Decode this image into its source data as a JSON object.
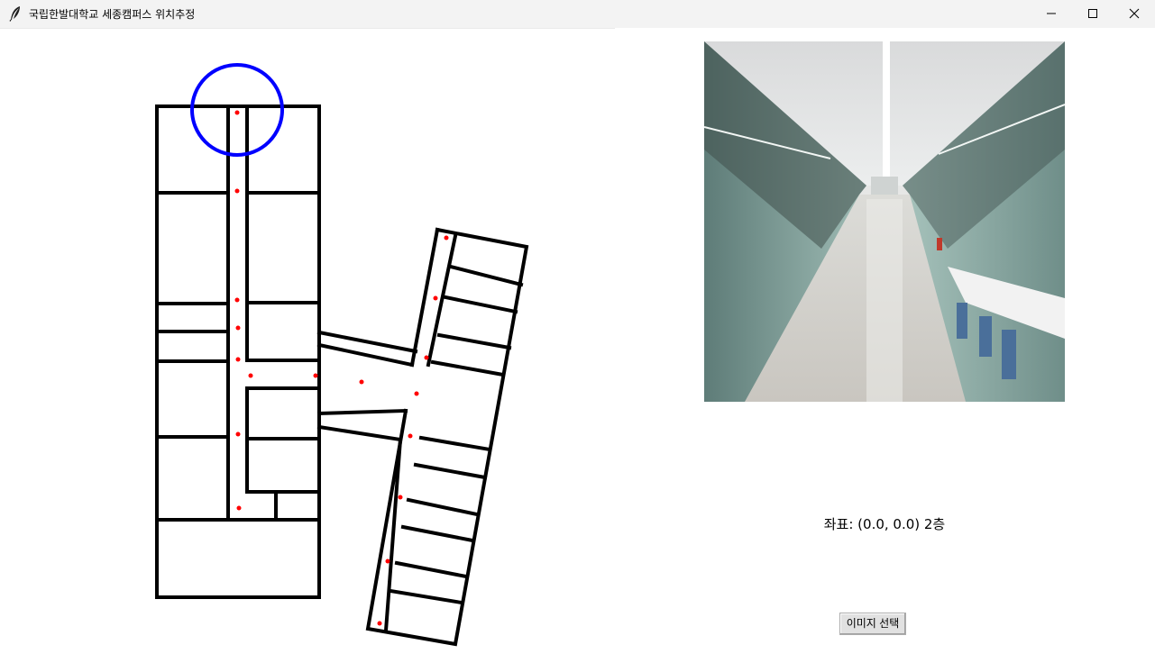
{
  "window": {
    "title": "국립한발대학교 세종캠퍼스 위치추정",
    "icon": "feather-icon",
    "controls": [
      "minimize-icon",
      "maximize-icon",
      "close-icon"
    ]
  },
  "map": {
    "marker_color": "#ff0000",
    "highlight_color": "#0000ff",
    "wall_color": "#000000"
  },
  "photo": {
    "subject": "corridor-photo"
  },
  "location": {
    "text": "좌표: (0.0, 0.0) 2층"
  },
  "actions": {
    "select_image_label": "이미지 선택"
  }
}
